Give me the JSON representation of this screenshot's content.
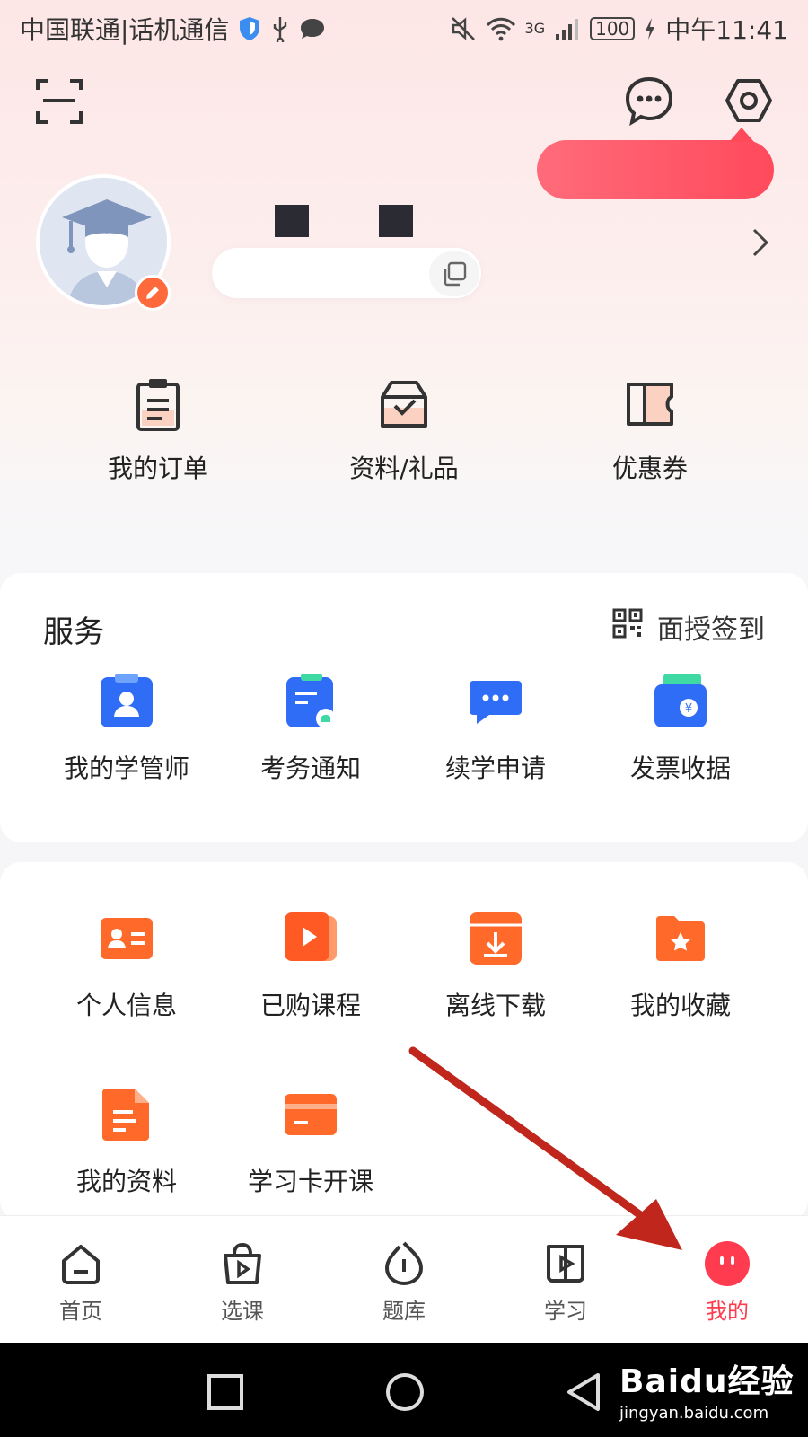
{
  "status_bar": {
    "carrier": "中国联通|话机通信",
    "network": "3G",
    "battery": "100",
    "time": "中午11:41"
  },
  "top_actions": {
    "scan_icon": "scan-icon",
    "message_icon": "message-icon",
    "settings_icon": "settings-icon"
  },
  "profile": {
    "avatar_icon": "graduate-avatar",
    "edit_icon": "pencil-icon",
    "copy_icon": "copy-icon",
    "arrow_icon": "chevron-right-icon"
  },
  "quick_links": [
    {
      "label": "我的订单",
      "icon": "clipboard-icon"
    },
    {
      "label": "资料/礼品",
      "icon": "inbox-check-icon"
    },
    {
      "label": "优惠券",
      "icon": "coupon-icon"
    }
  ],
  "services": {
    "title": "服务",
    "checkin_label": "面授签到",
    "checkin_icon": "qrcode-icon",
    "items": [
      {
        "label": "我的学管师",
        "icon": "advisor-icon"
      },
      {
        "label": "考务通知",
        "icon": "exam-notice-icon"
      },
      {
        "label": "续学申请",
        "icon": "chat-bubble-icon"
      },
      {
        "label": "发票收据",
        "icon": "wallet-icon"
      }
    ]
  },
  "tools": {
    "items": [
      {
        "label": "个人信息",
        "icon": "id-card-icon"
      },
      {
        "label": "已购课程",
        "icon": "video-play-icon"
      },
      {
        "label": "离线下载",
        "icon": "download-icon"
      },
      {
        "label": "我的收藏",
        "icon": "star-folder-icon"
      },
      {
        "label": "我的资料",
        "icon": "document-icon"
      },
      {
        "label": "学习卡开课",
        "icon": "card-icon"
      }
    ]
  },
  "bottom_nav": {
    "items": [
      {
        "label": "首页",
        "icon": "home-icon"
      },
      {
        "label": "选课",
        "icon": "bag-play-icon"
      },
      {
        "label": "题库",
        "icon": "question-bank-icon"
      },
      {
        "label": "学习",
        "icon": "book-play-icon"
      },
      {
        "label": "我的",
        "icon": "face-icon",
        "active": true
      }
    ]
  },
  "watermark": {
    "main": "Baidu经验",
    "sub": "jingyan.baidu.com"
  },
  "colors": {
    "accent_red": "#ff3b4f",
    "tool_orange": "#ff6a2b",
    "service_blue": "#2f6df6",
    "annotation_arrow": "#c0261c"
  }
}
